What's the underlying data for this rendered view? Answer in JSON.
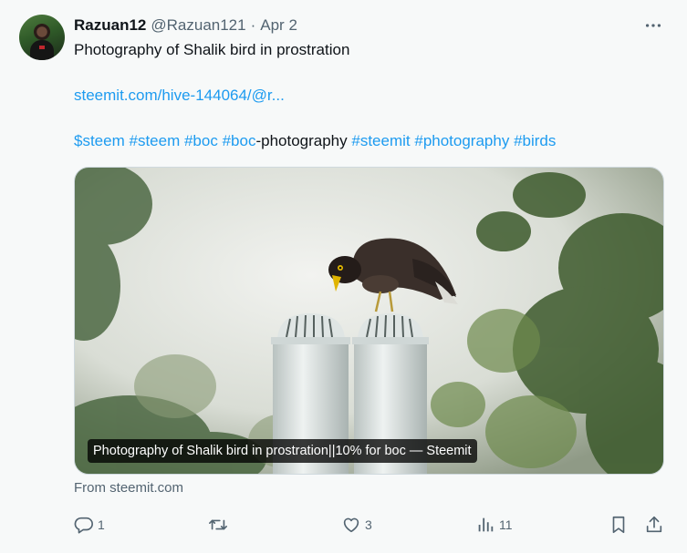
{
  "tweet": {
    "author_name": "Razuan12",
    "author_handle": "@Razuan121",
    "separator": "·",
    "date": "Apr 2",
    "text_line1": "Photography of Shalik bird in prostration",
    "link": "steemit.com/hive-144064/@r...",
    "tags": [
      {
        "text": "$steem",
        "is_link": true
      },
      {
        "text": " ",
        "is_link": false
      },
      {
        "text": "#steem",
        "is_link": true
      },
      {
        "text": " ",
        "is_link": false
      },
      {
        "text": "#boc",
        "is_link": true
      },
      {
        "text": " ",
        "is_link": false
      },
      {
        "text": "#boc",
        "is_link": true
      },
      {
        "text": "-photography",
        "is_link": false
      },
      {
        "text": " ",
        "is_link": false
      },
      {
        "text": "#steemit",
        "is_link": true
      },
      {
        "text": " ",
        "is_link": false
      },
      {
        "text": "#photography",
        "is_link": true
      },
      {
        "text": " ",
        "is_link": false
      },
      {
        "text": "#birds",
        "is_link": true
      }
    ]
  },
  "card": {
    "caption": "Photography of Shalik bird in prostration||10% for boc — Steemit",
    "source": "From steemit.com"
  },
  "actions": {
    "replies": "1",
    "reposts": "",
    "likes": "3",
    "views": "11"
  },
  "colors": {
    "link": "#1d9bf0",
    "secondary_text": "#536471",
    "background": "#f7f9f9"
  },
  "icons": [
    "more-icon",
    "reply-icon",
    "repost-icon",
    "like-icon",
    "views-icon",
    "bookmark-icon",
    "share-icon"
  ]
}
